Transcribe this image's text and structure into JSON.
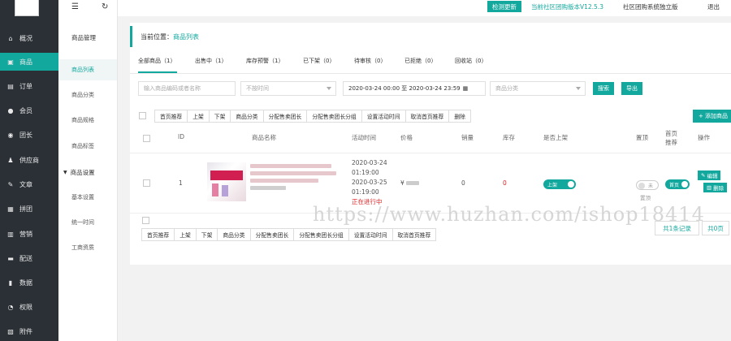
{
  "colors": {
    "accent": "#13a89e",
    "sidebar": "#2a3036",
    "danger": "#e02020"
  },
  "topbar": {
    "check_update": "检测更新",
    "version": "当前社区团购版本V12.5.3",
    "edition": "社区团购系统独立版",
    "logout": "退出",
    "menu_icon": "hamburger-icon",
    "refresh_icon": "refresh-icon"
  },
  "sidebar": {
    "items": [
      {
        "label": "概况",
        "icon": "home-icon"
      },
      {
        "label": "商品",
        "icon": "goods-icon"
      },
      {
        "label": "订单",
        "icon": "order-icon"
      },
      {
        "label": "会员",
        "icon": "user-icon"
      },
      {
        "label": "团长",
        "icon": "leader-icon"
      },
      {
        "label": "供应商",
        "icon": "supplier-icon"
      },
      {
        "label": "文章",
        "icon": "article-icon"
      },
      {
        "label": "拼团",
        "icon": "group-icon"
      },
      {
        "label": "营销",
        "icon": "marketing-icon"
      },
      {
        "label": "配送",
        "icon": "delivery-icon"
      },
      {
        "label": "数据",
        "icon": "chart-icon"
      },
      {
        "label": "权限",
        "icon": "lock-icon"
      },
      {
        "label": "附件",
        "icon": "attachment-icon"
      }
    ]
  },
  "subnav": {
    "header": "商品管理",
    "items": [
      "商品列表",
      "商品分类",
      "商品规格",
      "商品标签"
    ],
    "settings_header": "商品设置",
    "settings_items": [
      "基本设置",
      "统一时间",
      "工商资质"
    ]
  },
  "breadcrumb": {
    "prefix": "当前位置：",
    "current": "商品列表"
  },
  "tabs": [
    "全部商品（1）",
    "出售中（1）",
    "库存预警（1）",
    "已下架（0）",
    "待审核（0）",
    "已拒绝（0）",
    "回收站（0）"
  ],
  "filters": {
    "keyword_placeholder": "输入商品编码或者名称",
    "time_select": "不按时间",
    "date_range": "2020-03-24 00:00 至 2020-03-24 23:59",
    "category_placeholder": "商品分类",
    "search": "搜索",
    "export": "导出",
    "add_goods": "+ 添加商品"
  },
  "bulk_actions": [
    "首页推荐",
    "上架",
    "下架",
    "商品分类",
    "分配售卖团长",
    "分配售卖团长分组",
    "设置活动时间",
    "取消首页推荐",
    "删除"
  ],
  "table": {
    "headers": [
      "ID",
      "商品名称",
      "活动时间",
      "价格",
      "销量",
      "库存",
      "是否上架",
      "置顶",
      "首页推荐",
      "操作"
    ],
    "rows": [
      {
        "id": "1",
        "time_start": "2020-03-24",
        "time_start2": "01:19:00",
        "time_end": "2020-03-25",
        "time_end2": "01:19:00",
        "status": "正在进行中",
        "price": "¥",
        "sales": "0",
        "stock": "0",
        "onshelf": "上架",
        "top": "未",
        "top_label": "置顶",
        "recommend": "首页",
        "edit": "编辑",
        "delete": "删除"
      }
    ]
  },
  "pagination": {
    "total": "共1条记录",
    "pages": "共0页"
  },
  "watermark": "https://www.huzhan.com/ishop18414"
}
